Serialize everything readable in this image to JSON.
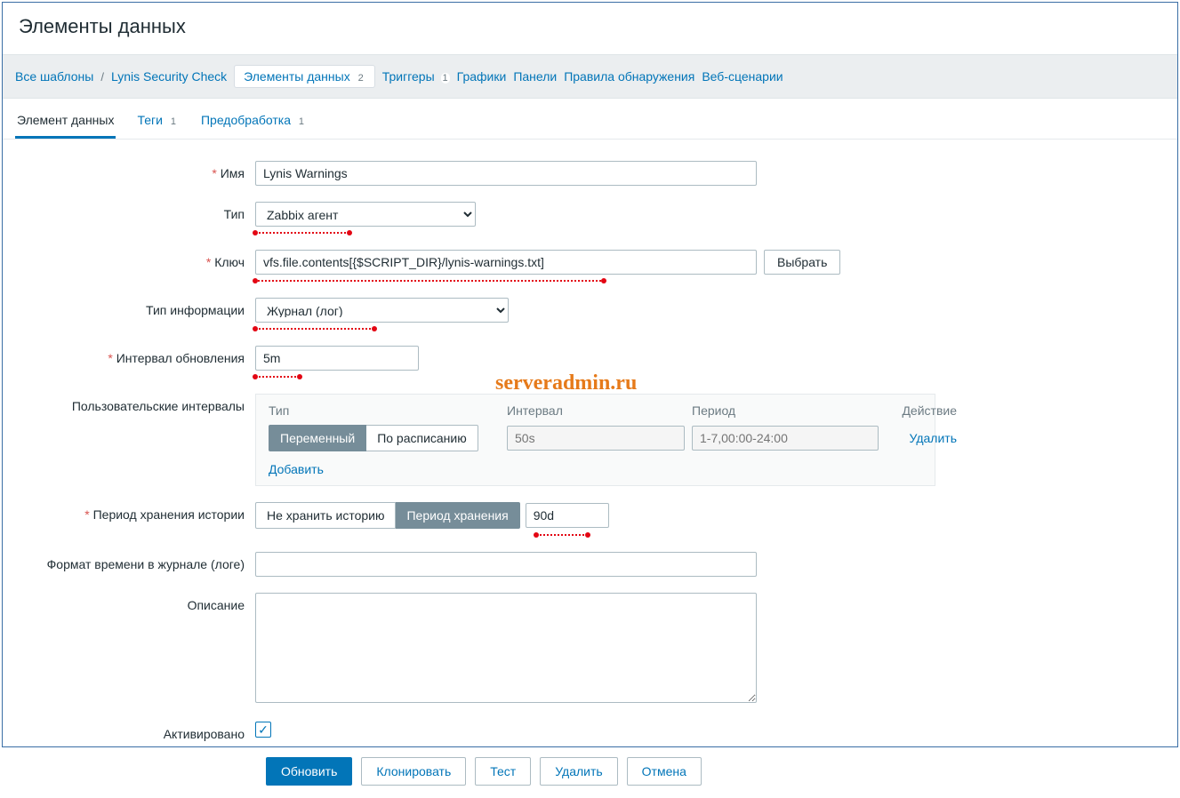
{
  "page": {
    "title": "Элементы данных"
  },
  "breadcrumb": {
    "all_templates": "Все шаблоны",
    "template_name": "Lynis Security Check",
    "items": {
      "label": "Элементы данных",
      "count": "2"
    },
    "triggers": {
      "label": "Триггеры",
      "count": "1"
    },
    "graphs": "Графики",
    "panels": "Панели",
    "discovery": "Правила обнаружения",
    "web": "Веб-сценарии"
  },
  "tabs": {
    "item": "Элемент данных",
    "tags": {
      "label": "Теги",
      "count": "1"
    },
    "preproc": {
      "label": "Предобработка",
      "count": "1"
    }
  },
  "labels": {
    "name": "Имя",
    "type": "Тип",
    "key": "Ключ",
    "info_type": "Тип информации",
    "update_interval": "Интервал обновления",
    "custom_intervals": "Пользовательские интервалы",
    "history": "Период хранения истории",
    "log_time_format": "Формат времени в журнале (логе)",
    "description": "Описание",
    "enabled": "Активировано"
  },
  "values": {
    "name": "Lynis Warnings",
    "type": "Zabbix агент",
    "key": "vfs.file.contents[{$SCRIPT_DIR}/lynis-warnings.txt]",
    "info_type": "Журнал (лог)",
    "update_interval": "5m",
    "history_value": "90d",
    "log_time_format": "",
    "description": ""
  },
  "buttons": {
    "select": "Выбрать",
    "update": "Обновить",
    "clone": "Клонировать",
    "test": "Тест",
    "delete": "Удалить",
    "cancel": "Отмена"
  },
  "intervals": {
    "head": {
      "type": "Тип",
      "interval": "Интервал",
      "period": "Период",
      "action": "Действие"
    },
    "seg_flexible": "Переменный",
    "seg_scheduling": "По расписанию",
    "interval_placeholder": "50s",
    "period_placeholder": "1-7,00:00-24:00",
    "delete": "Удалить",
    "add": "Добавить"
  },
  "history": {
    "no_store": "Не хранить историю",
    "store": "Период хранения"
  },
  "watermark": "serveradmin.ru"
}
